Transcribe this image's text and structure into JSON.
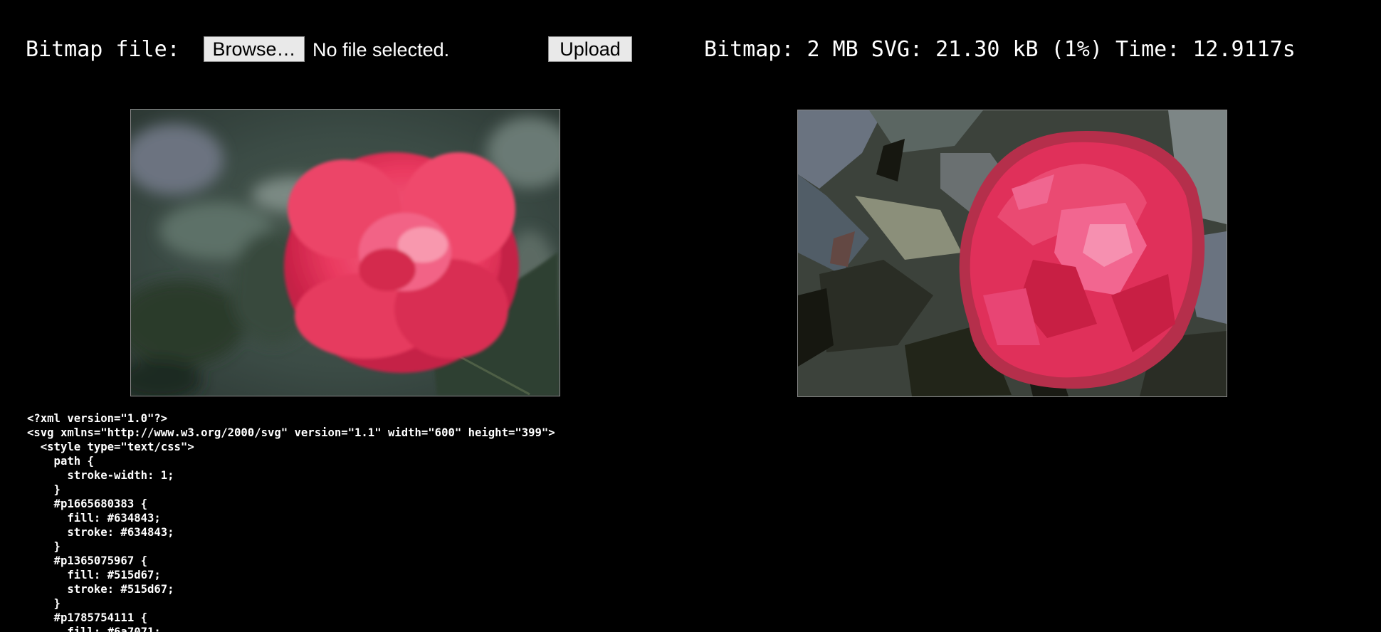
{
  "upload_bar": {
    "file_label": "Bitmap file:",
    "browse_label": "Browse…",
    "no_file_text": "No file selected.",
    "upload_label": "Upload"
  },
  "stats": {
    "text": "Bitmap: 2 MB SVG: 21.30 kB (1%) Time: 12.9117s"
  },
  "images": {
    "original_desc": "original bitmap photo of pink camellia flower",
    "vectorized_desc": "vectorized svg rendering of camellia flower"
  },
  "code_lines": [
    "<?xml version=\"1.0\"?>",
    "<svg xmlns=\"http://www.w3.org/2000/svg\" version=\"1.1\" width=\"600\" height=\"399\">",
    "  <style type=\"text/css\">",
    "    path {",
    "      stroke-width: 1;",
    "    }",
    "    #p1665680383 {",
    "      fill: #634843;",
    "      stroke: #634843;",
    "    }",
    "    #p1365075967 {",
    "      fill: #515d67;",
    "      stroke: #515d67;",
    "    }",
    "    #p1785754111 {",
    "      fill: #6a7071;"
  ],
  "colors": {
    "background": "#000000",
    "text": "#ffffff",
    "button_bg": "#e9e9e9",
    "flower_pink": "#e8345a"
  }
}
